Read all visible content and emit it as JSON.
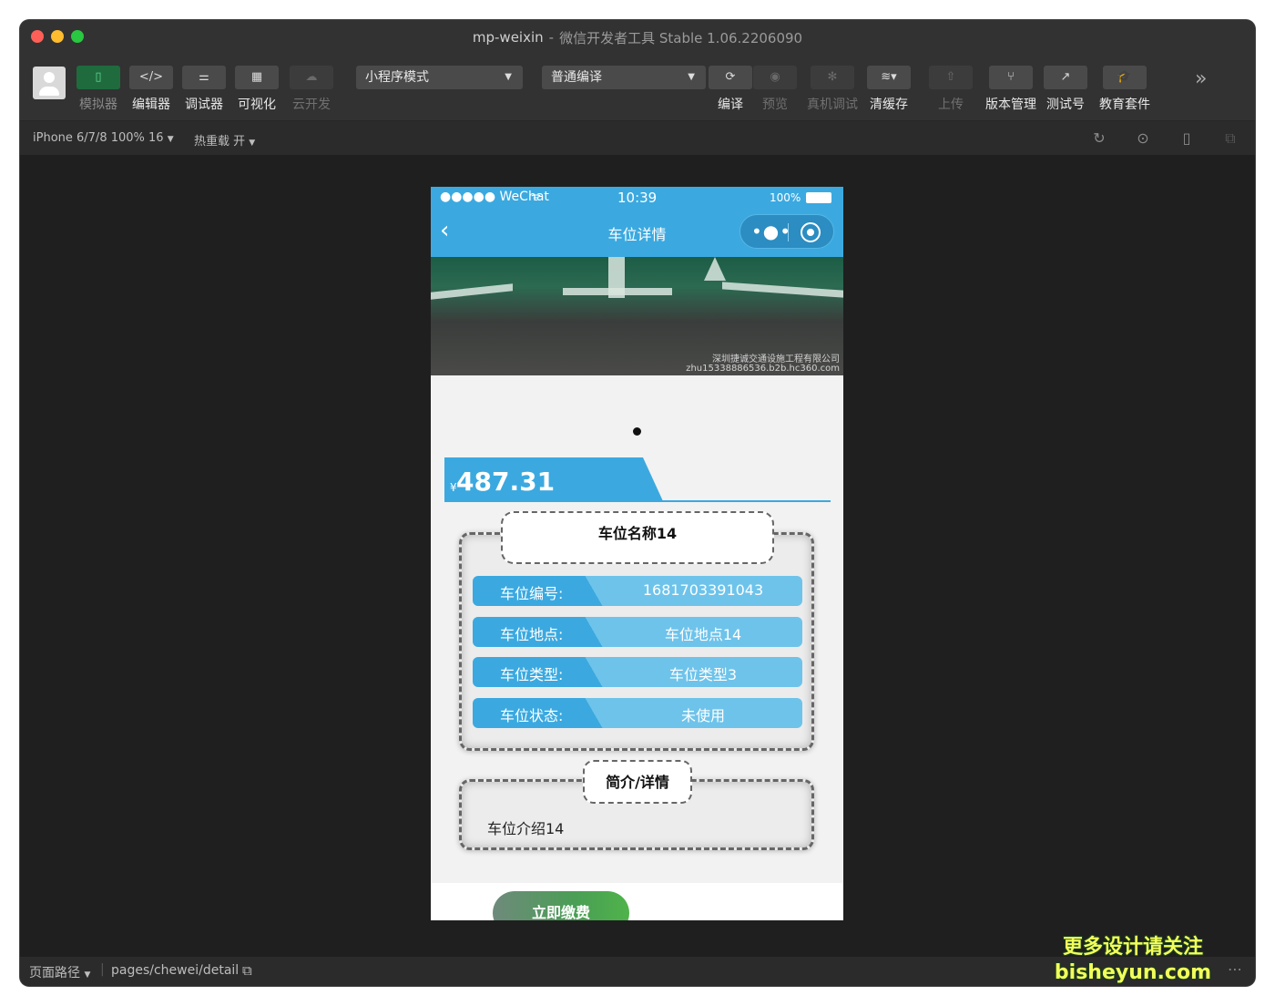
{
  "window": {
    "app_name": "mp-weixin",
    "subtitle": "微信开发者工具 Stable 1.06.2206090"
  },
  "toolbar": {
    "simulator": "模拟器",
    "editor": "编辑器",
    "debugger": "调试器",
    "visual": "可视化",
    "cloud": "云开发",
    "mode_select": "小程序模式",
    "compile_select": "普通编译",
    "compile": "编译",
    "preview": "预览",
    "remote_debug": "真机调试",
    "clear_cache": "清缓存",
    "upload": "上传",
    "version": "版本管理",
    "test_account": "测试号",
    "education": "教育套件"
  },
  "subbar": {
    "device": "iPhone 6/7/8 100% 16",
    "hot_reload": "热重载 开"
  },
  "phone": {
    "status": {
      "carrier": "●●●●● WeChat",
      "time": "10:39",
      "battery": "100%"
    },
    "nav": {
      "title": "车位详情"
    },
    "banner_watermark": [
      "深圳捷诚交通设施工程有限公司",
      "zhu15338886536.b2b.hc360.com"
    ],
    "price": {
      "currency": "¥",
      "value": "487.31"
    },
    "spot_name": "车位名称14",
    "fields": [
      {
        "key": "车位编号:",
        "value": "1681703391043"
      },
      {
        "key": "车位地点:",
        "value": "车位地点14"
      },
      {
        "key": "车位类型:",
        "value": "车位类型3"
      },
      {
        "key": "车位状态:",
        "value": "未使用"
      }
    ],
    "intro_title": "简介/详情",
    "intro_text": "车位介绍14",
    "pay_button": "立即缴费"
  },
  "bottom": {
    "path_label": "页面路径",
    "path": "pages/chewei/detail"
  },
  "promo": {
    "line1": "更多设计请关注",
    "line2": "bisheyun.com"
  }
}
